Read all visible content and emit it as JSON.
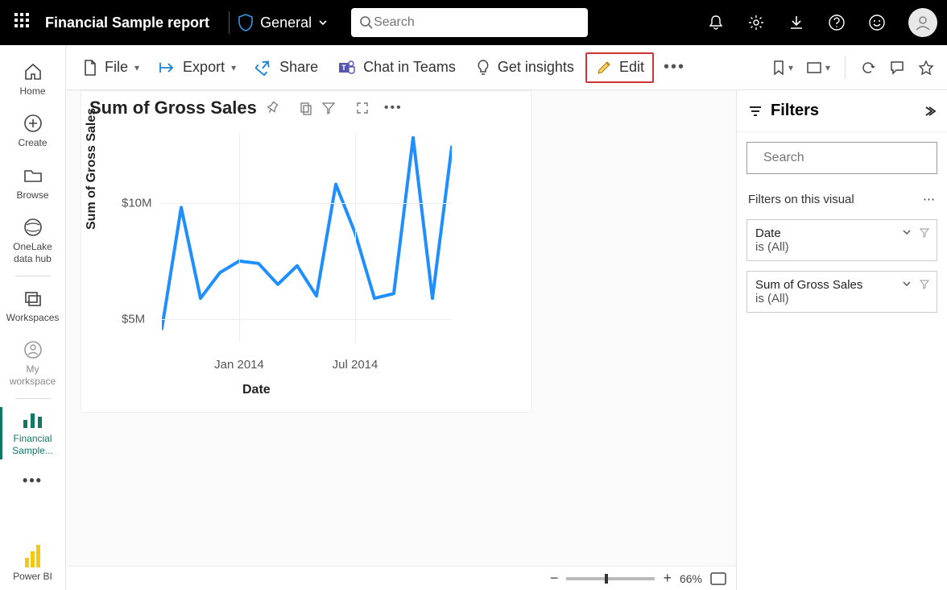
{
  "topbar": {
    "report_title": "Financial Sample report",
    "sensitivity_label": "General",
    "search_placeholder": "Search"
  },
  "leftnav": {
    "items": [
      {
        "label": "Home"
      },
      {
        "label": "Create"
      },
      {
        "label": "Browse"
      },
      {
        "label": "OneLake data hub"
      },
      {
        "label": "Workspaces"
      },
      {
        "label": "My workspace"
      },
      {
        "label": "Financial Sample..."
      }
    ],
    "footer_label": "Power BI"
  },
  "cmdbar": {
    "file": "File",
    "export": "Export",
    "share": "Share",
    "chat": "Chat in Teams",
    "insights": "Get insights",
    "edit": "Edit"
  },
  "visual": {
    "title": "Sum of Gross Sales",
    "y_label": "Sum of Gross Sales",
    "x_label": "Date",
    "y_tick_10": "$10M",
    "y_tick_5": "$5M",
    "x_tick_jan": "Jan 2014",
    "x_tick_jul": "Jul 2014"
  },
  "filters": {
    "title": "Filters",
    "search_placeholder": "Search",
    "section_header": "Filters on this visual",
    "cards": [
      {
        "name": "Date",
        "value": "is (All)"
      },
      {
        "name": "Sum of Gross Sales",
        "value": "is (All)"
      }
    ]
  },
  "statusbar": {
    "zoom_pct": "66%"
  },
  "chart_data": {
    "type": "line",
    "title": "Sum of Gross Sales",
    "xlabel": "Date",
    "ylabel": "Sum of Gross Sales",
    "ylim": [
      4,
      13
    ],
    "x": [
      "Sep 2013",
      "Oct 2013",
      "Nov 2013",
      "Dec 2013",
      "Jan 2014",
      "Feb 2014",
      "Mar 2014",
      "Apr 2014",
      "May 2014",
      "Jun 2014",
      "Jul 2014",
      "Aug 2014",
      "Sep 2014",
      "Oct 2014",
      "Nov 2014",
      "Dec 2014"
    ],
    "values": [
      4.6,
      9.8,
      5.9,
      7.0,
      7.5,
      7.4,
      6.5,
      7.3,
      6.0,
      10.4,
      8.3,
      5.9,
      6.1,
      12.4,
      5.9,
      12.0
    ]
  }
}
